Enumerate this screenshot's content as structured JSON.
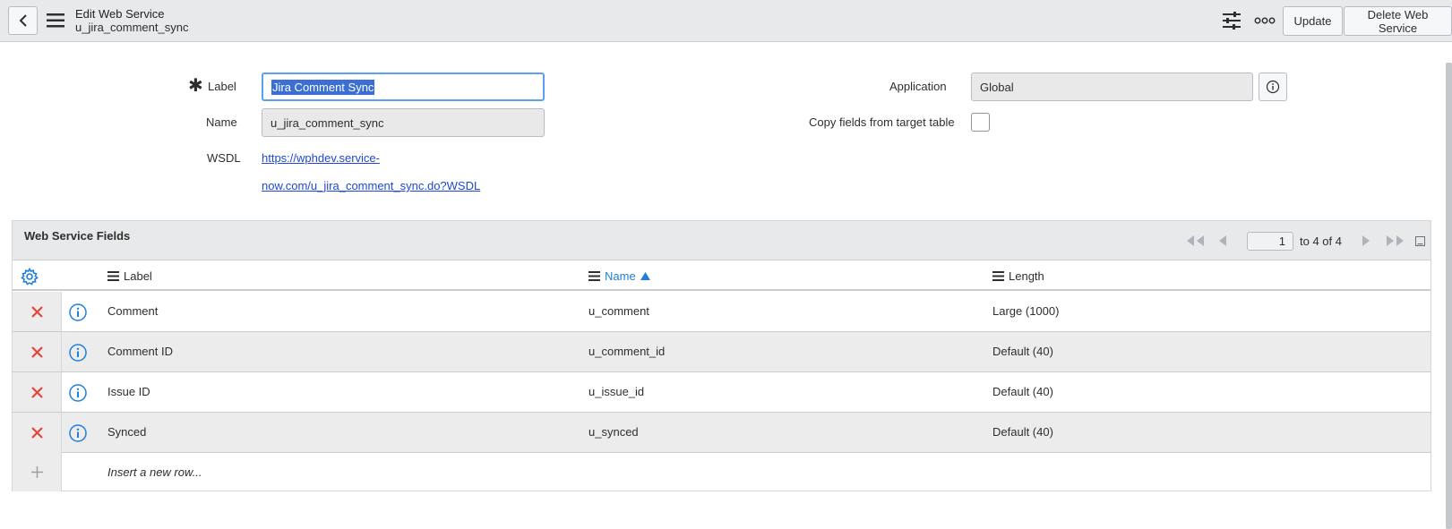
{
  "header": {
    "title": "Edit Web Service",
    "subtitle": "u_jira_comment_sync",
    "update_label": "Update",
    "delete_label": "Delete Web Service"
  },
  "form": {
    "label_label": "Label",
    "label_value": "Jira Comment Sync",
    "name_label": "Name",
    "name_value": "u_jira_comment_sync",
    "wsdl_label": "WSDL",
    "wsdl_line1": "https://wphdev.service-",
    "wsdl_line2": "now.com/u_jira_comment_sync.do?WSDL",
    "application_label": "Application",
    "application_value": "Global",
    "copy_fields_label": "Copy fields from target table",
    "copy_fields_checked": false
  },
  "related_list": {
    "title": "Web Service Fields",
    "page_value": "1",
    "page_text": "to 4 of 4",
    "columns": {
      "label": "Label",
      "name": "Name",
      "length": "Length"
    },
    "rows": [
      {
        "label": "Comment",
        "name": "u_comment",
        "length": "Large (1000)"
      },
      {
        "label": "Comment ID",
        "name": "u_comment_id",
        "length": "Default (40)"
      },
      {
        "label": "Issue ID",
        "name": "u_issue_id",
        "length": "Default (40)"
      },
      {
        "label": "Synced",
        "name": "u_synced",
        "length": "Default (40)"
      }
    ],
    "insert_text": "Insert a new row..."
  },
  "colors": {
    "accent_blue": "#1f7fd9",
    "delete_red": "#e2453c",
    "link_blue": "#1f48d6",
    "focus_border": "#5aa0f2"
  }
}
